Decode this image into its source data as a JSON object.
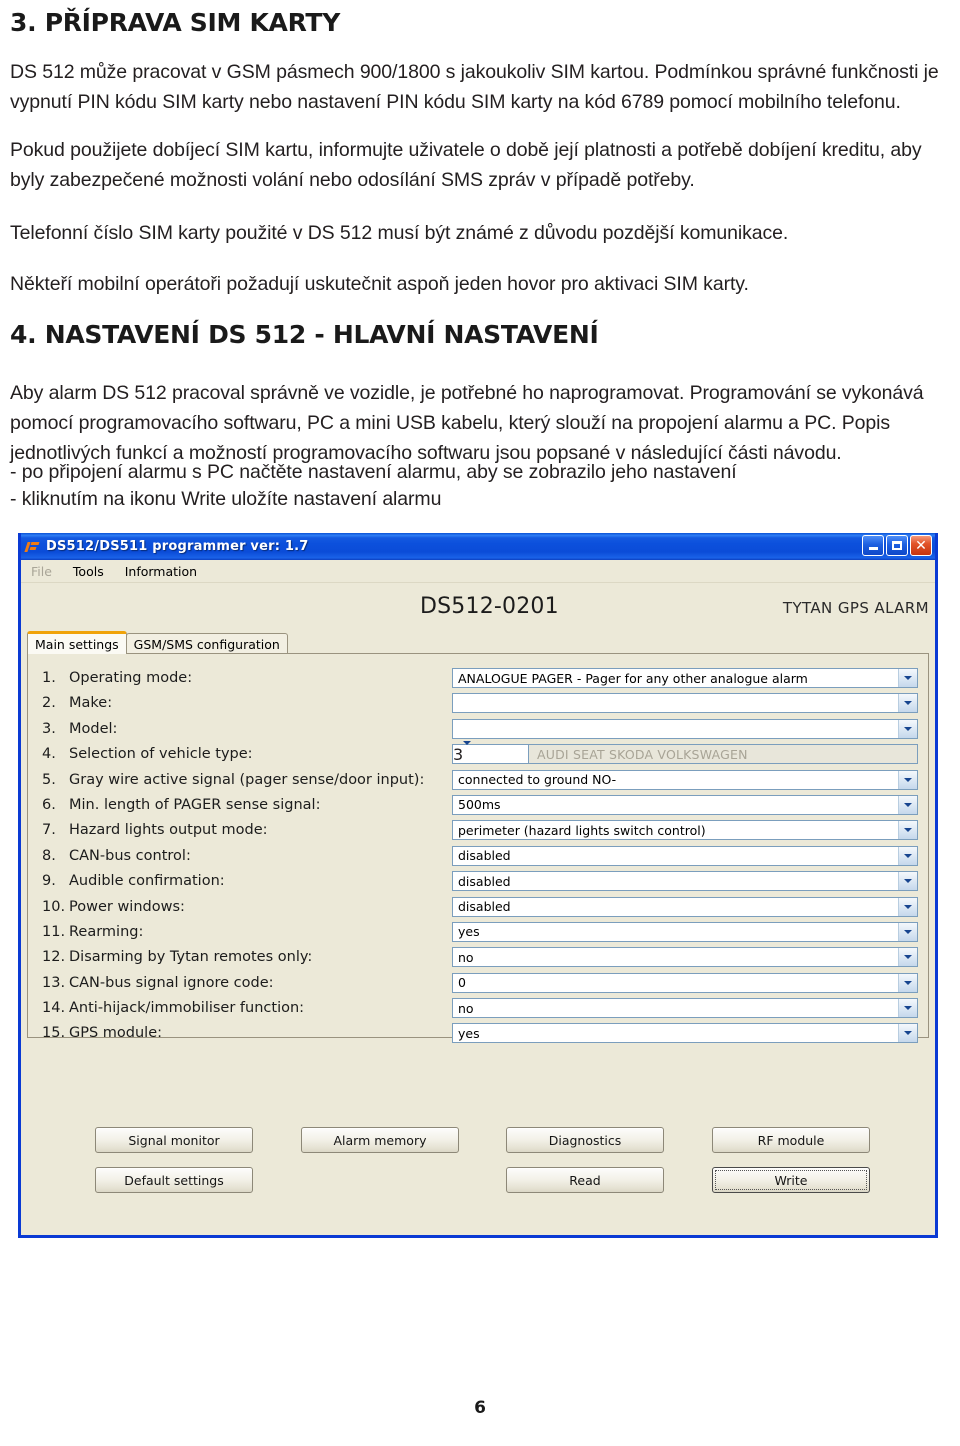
{
  "document": {
    "heading_3": "3. PŘÍPRAVA SIM KARTY",
    "para_1": "DS 512 může pracovat v GSM pásmech 900/1800 s jakoukoliv SIM kartou. Podmínkou správné funkčnosti je vypnutí PIN kódu SIM karty nebo nastavení PIN kódu SIM karty na kód 6789 pomocí mobilního telefonu.",
    "para_2": "Pokud použijete dobíjecí SIM kartu, informujte uživatele o době její platnosti a potřebě dobíjení kreditu, aby byly zabezpečené možnosti volání nebo odosílání SMS zpráv v případě potřeby.",
    "para_3": "Telefonní číslo SIM karty použité v DS 512 musí být známé z důvodu pozdější komunikace.",
    "para_4": "Někteří mobilní operátoři požadují uskutečnit aspoň jeden hovor pro aktivaci SIM karty.",
    "heading_4": "4. NASTAVENÍ DS 512 - HLAVNÍ NASTAVENÍ",
    "para_5": "Aby alarm DS 512 pracoval správně ve vozidle, je potřebné ho naprogramovat. Programování se vykonává pomocí programovacího softwaru, PC a mini USB kabelu, který slouží na propojení alarmu a PC. Popis jednotlivých funkcí a možností programovacího softwaru jsou popsané v následující části návodu.",
    "bullet_1": "- po připojení alarmu s PC načtěte nastavení alarmu, aby se zobrazilo jeho nastavení",
    "bullet_2": "- kliknutím na ikonu Write uložíte nastavení alarmu",
    "page_number": "6"
  },
  "app": {
    "title": "DS512/DS511 programmer ver: 1.7",
    "titlebar_icon": "app-logo-icon",
    "window_buttons": {
      "minimize": "minimize-icon",
      "maximize": "maximize-icon",
      "close": "close-icon"
    },
    "menu": [
      {
        "label": "File",
        "disabled": true
      },
      {
        "label": "Tools",
        "disabled": false
      },
      {
        "label": "Information",
        "disabled": false
      }
    ],
    "device_id": "DS512-0201",
    "brand": "TYTAN GPS  ALARM",
    "tabs": [
      {
        "label": "Main settings",
        "active": true
      },
      {
        "label": "GSM/SMS configuration",
        "active": false
      }
    ],
    "settings": [
      {
        "num": "1.",
        "label": "Operating mode:",
        "value": "ANALOGUE PAGER - Pager for any other analogue alarm",
        "type": "combo"
      },
      {
        "num": "2.",
        "label": "Make:",
        "value": "",
        "type": "combo"
      },
      {
        "num": "3.",
        "label": "Model:",
        "value": "",
        "type": "combo"
      },
      {
        "num": "4.",
        "label": "Selection of vehicle type:",
        "value": "3",
        "readonly_value": "AUDI SEAT SKODA VOLKSWAGEN",
        "type": "combo-with-readonly"
      },
      {
        "num": "5.",
        "label": "Gray wire active signal (pager sense/door input):",
        "value": "connected to ground NO-",
        "type": "combo"
      },
      {
        "num": "6.",
        "label": "Min. length of PAGER sense signal:",
        "value": "500ms",
        "type": "combo"
      },
      {
        "num": "7.",
        "label": "Hazard lights output mode:",
        "value": "perimeter (hazard lights switch control)",
        "type": "combo"
      },
      {
        "num": "8.",
        "label": "CAN-bus control:",
        "value": "disabled",
        "type": "combo"
      },
      {
        "num": "9.",
        "label": "Audible confirmation:",
        "value": "disabled",
        "type": "combo"
      },
      {
        "num": "10.",
        "label": "Power windows:",
        "value": "disabled",
        "type": "combo"
      },
      {
        "num": "11.",
        "label": "Rearming:",
        "value": "yes",
        "type": "combo"
      },
      {
        "num": "12.",
        "label": "Disarming by Tytan remotes only:",
        "value": "no",
        "type": "combo"
      },
      {
        "num": "13.",
        "label": "CAN-bus signal ignore code:",
        "value": "0",
        "type": "combo"
      },
      {
        "num": "14.",
        "label": "Anti-hijack/immobiliser function:",
        "value": "no",
        "type": "combo"
      },
      {
        "num": "15.",
        "label": "GPS module:",
        "value": "yes",
        "type": "combo"
      }
    ],
    "buttons": {
      "signal_monitor": "Signal monitor",
      "alarm_memory": "Alarm memory",
      "diagnostics": "Diagnostics",
      "rf_module": "RF module",
      "default_settings": "Default settings",
      "read": "Read",
      "write": "Write"
    },
    "colors": {
      "titlebar_blue": "#0c50dc",
      "window_border": "#0a3ad4",
      "face": "#ece9d8",
      "active_tab_accent": "#f0a30a",
      "combo_border": "#7b9ebd",
      "close_button": "#c7340f"
    }
  }
}
